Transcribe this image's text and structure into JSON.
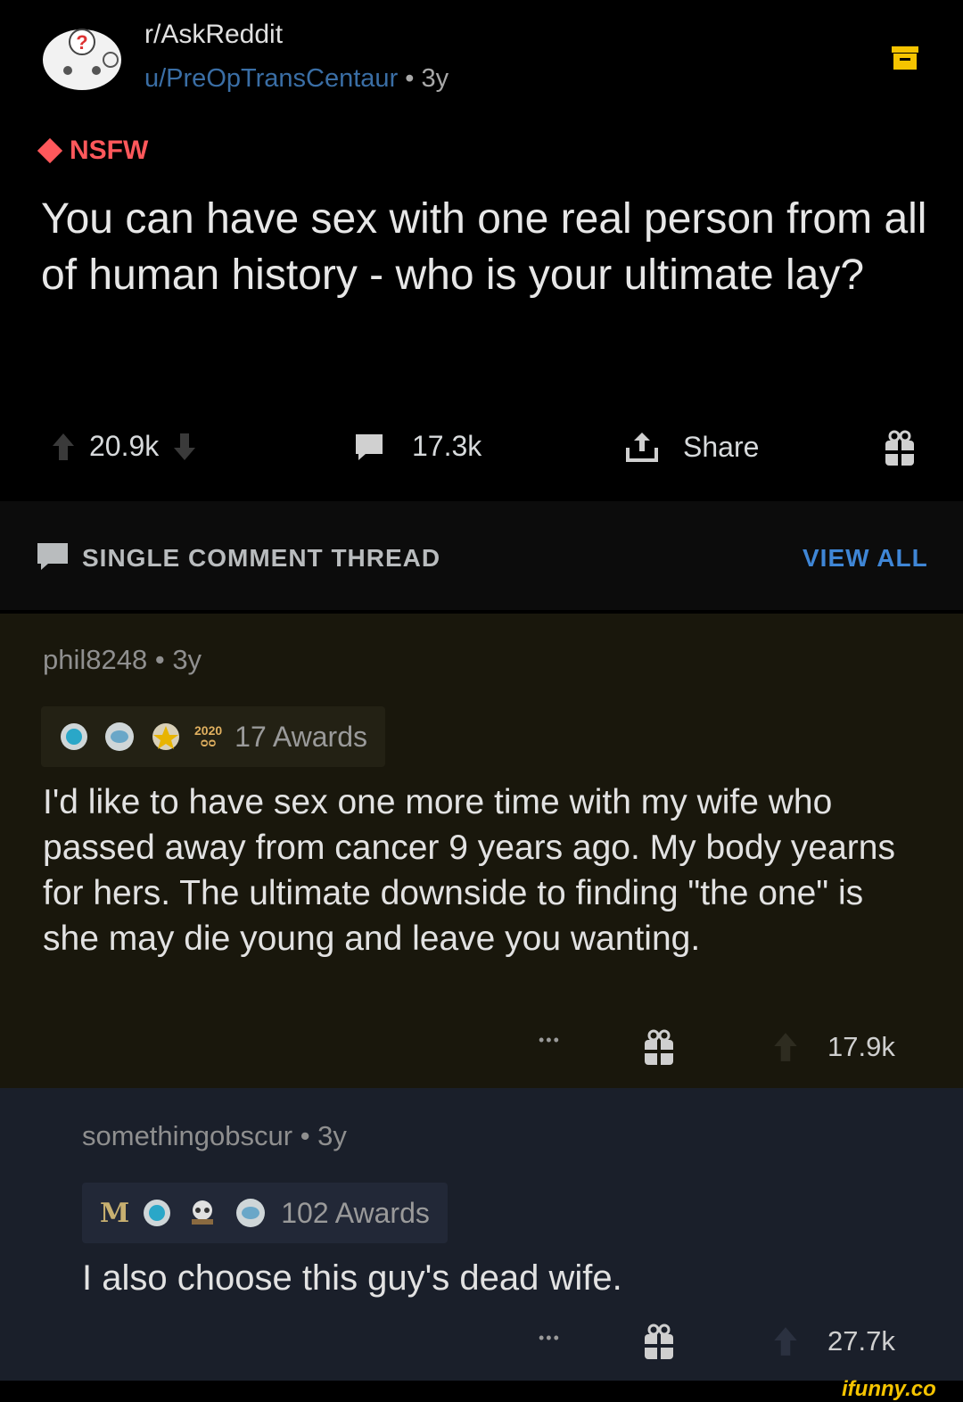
{
  "post": {
    "subreddit": "r/AskReddit",
    "username": "u/PreOpTransCentaur",
    "age_separator": " • ",
    "age": "3y",
    "nsfw_label": "NSFW",
    "title": "You can have sex with one real person from all of human history - who is your ultimate lay?",
    "upvotes": "20.9k",
    "comments": "17.3k",
    "share_label": "Share",
    "icons": [
      "subreddit-avatar-icon",
      "archive-icon",
      "upvote-icon",
      "downvote-icon",
      "comment-icon",
      "share-icon",
      "gift-icon"
    ]
  },
  "thread": {
    "label": "SINGLE COMMENT THREAD",
    "view_all": "VIEW ALL"
  },
  "comments": [
    {
      "author": "phil8248",
      "age": "3y",
      "awards": "17 Awards",
      "award_year": "2020",
      "body": "I'd like to have sex one more time with my wife who passed away from cancer 9 years ago.  My body yearns for hers.  The ultimate downside to finding \"the one\" is she may die young and leave you wanting.",
      "more": "•••",
      "score": "17.9k"
    },
    {
      "author": "somethingobscur",
      "age": "3y",
      "awards": "102 Awards",
      "award_letter": "M",
      "body": "I also choose this guy's dead wife.",
      "more": "•••",
      "score": "27.7k"
    }
  ],
  "watermark": "ifunny.co",
  "colors": {
    "background": "#000000",
    "nsfw": "#ff585b",
    "username": "#3a6ea5",
    "view_all": "#3f86d6",
    "comment1_bg": "#19170c",
    "comment2_bg": "#1a1f2a",
    "watermark": "#f5c400"
  }
}
